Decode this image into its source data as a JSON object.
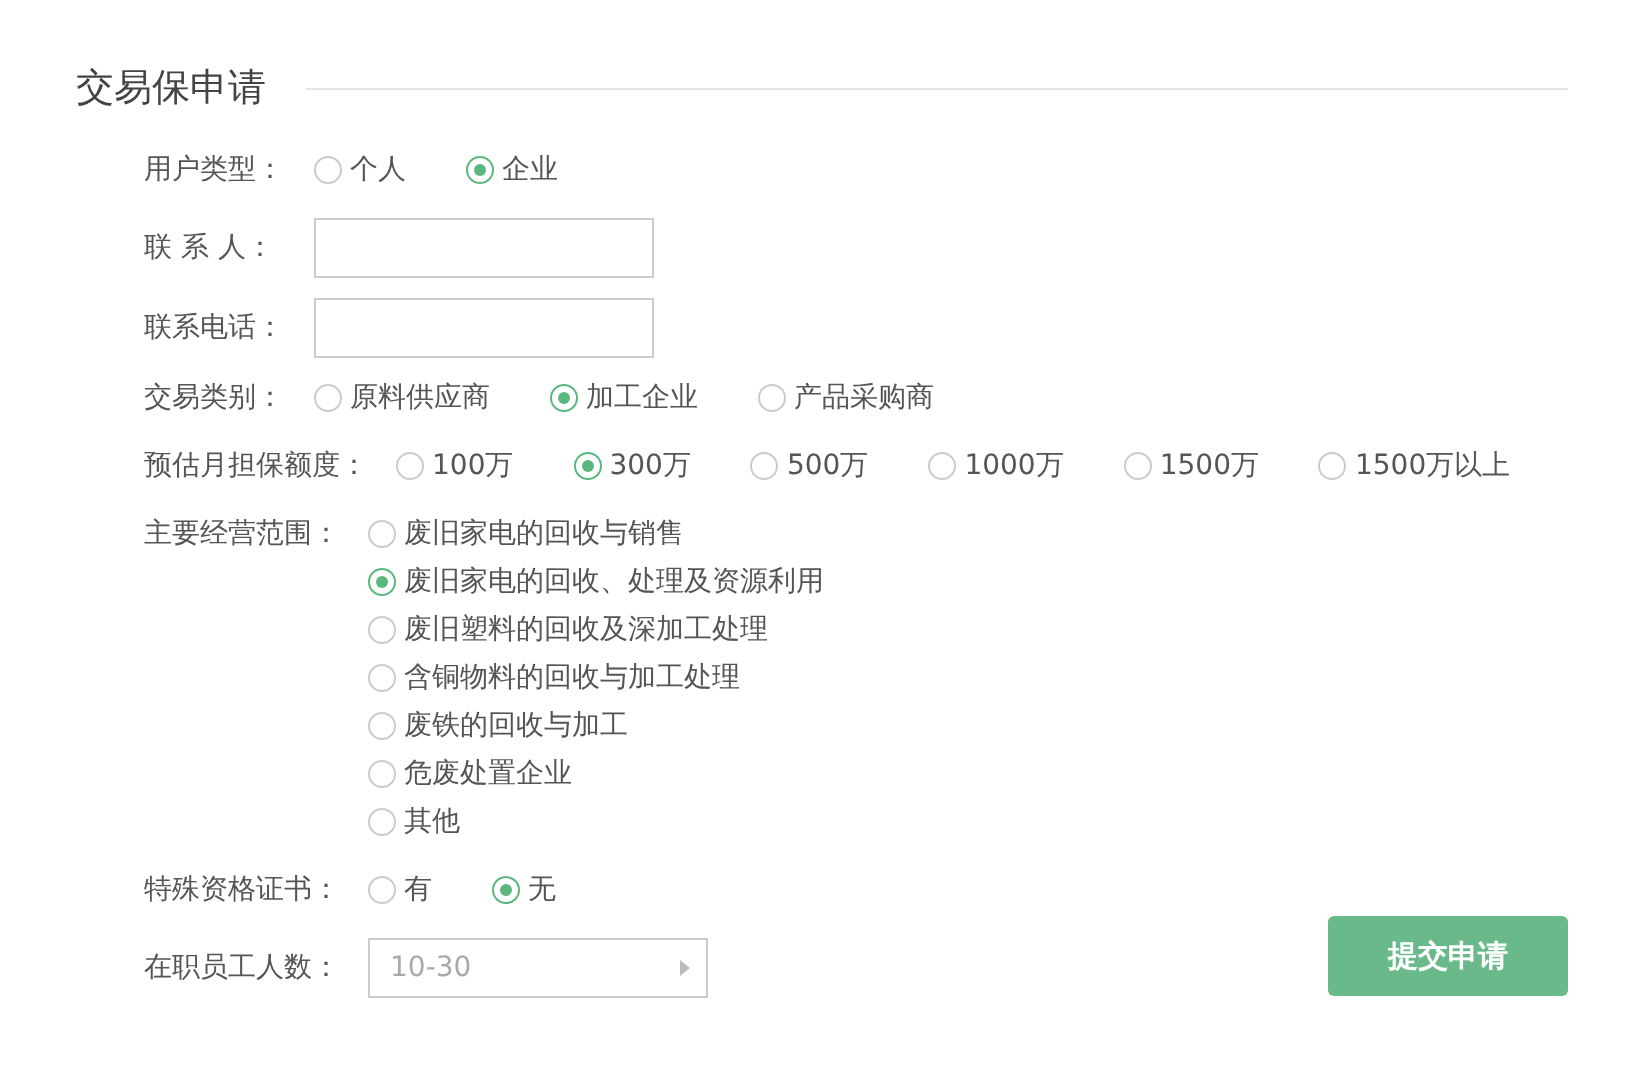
{
  "title": "交易保申请",
  "fields": [
    {
      "kind": "radio",
      "label": "用户类型：",
      "options": [
        {
          "label": "个人",
          "selected": false
        },
        {
          "label": "企业",
          "selected": true
        }
      ]
    },
    {
      "kind": "input",
      "label": "联 系 人："
    },
    {
      "kind": "input",
      "label": "联系电话："
    },
    {
      "kind": "radio",
      "label": "交易类别：",
      "options": [
        {
          "label": "原料供应商",
          "selected": false
        },
        {
          "label": "加工企业",
          "selected": true
        },
        {
          "label": "产品采购商",
          "selected": false
        }
      ]
    },
    {
      "kind": "radio",
      "label": "预估月担保额度：",
      "options": [
        {
          "label": "100万",
          "selected": false
        },
        {
          "label": "300万",
          "selected": true
        },
        {
          "label": "500万",
          "selected": false
        },
        {
          "label": "1000万",
          "selected": false
        },
        {
          "label": "1500万",
          "selected": false
        },
        {
          "label": "1500万以上",
          "selected": false
        }
      ]
    },
    {
      "kind": "radio_list",
      "label": "主要经营范围：",
      "options": [
        {
          "label": "废旧家电的回收与销售",
          "selected": false
        },
        {
          "label": "废旧家电的回收、处理及资源利用",
          "selected": true
        },
        {
          "label": "废旧塑料的回收及深加工处理",
          "selected": false
        },
        {
          "label": "含铜物料的回收与加工处理",
          "selected": false
        },
        {
          "label": "废铁的回收与加工",
          "selected": false
        },
        {
          "label": "危废处置企业",
          "selected": false
        },
        {
          "label": "其他",
          "selected": false
        }
      ]
    },
    {
      "kind": "radio",
      "label": "特殊资格证书：",
      "options": [
        {
          "label": "有",
          "selected": false
        },
        {
          "label": "无",
          "selected": true
        }
      ]
    },
    {
      "kind": "select",
      "label": "在职员工人数：",
      "value": "10-30"
    }
  ],
  "submit": "提交申请"
}
